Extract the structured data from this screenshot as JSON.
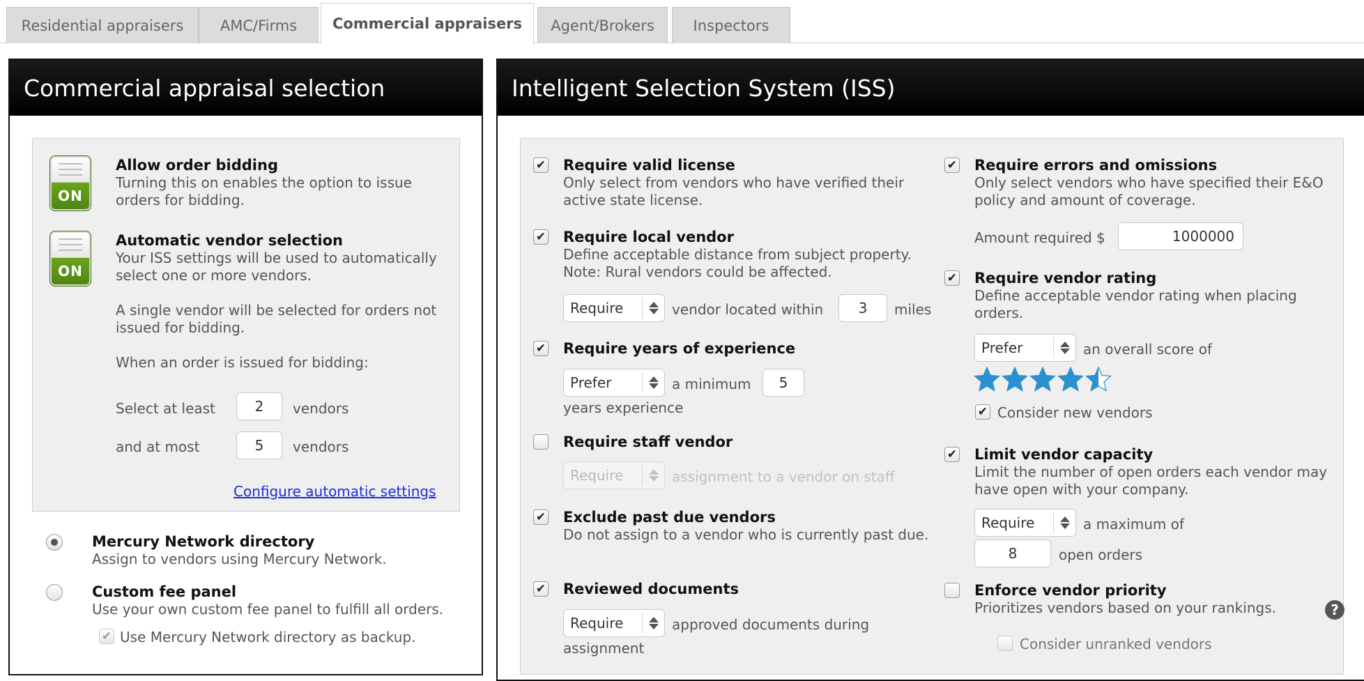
{
  "tabs": [
    {
      "label": "Residential appraisers"
    },
    {
      "label": "AMC/Firms"
    },
    {
      "label": "Commercial appraisers"
    },
    {
      "label": "Agent/Brokers"
    },
    {
      "label": "Inspectors"
    }
  ],
  "left": {
    "title": "Commercial appraisal selection",
    "bidding": {
      "toggle": "ON",
      "title": "Allow order bidding",
      "desc": "Turning this on enables the option to issue orders for bidding."
    },
    "auto": {
      "toggle": "ON",
      "title": "Automatic vendor selection",
      "desc": "Your ISS settings will be used to automatically select one or more vendors.",
      "single": "A single vendor will be selected for orders not issued for bidding.",
      "when": "When an order is issued for bidding:",
      "at_least_label": "Select at least",
      "at_least_value": "2",
      "at_most_label": "and at most",
      "at_most_value": "5",
      "vendors_word": "vendors"
    },
    "configure_link": "Configure automatic settings",
    "mercury": {
      "title": "Mercury Network directory",
      "desc": "Assign to vendors using Mercury Network."
    },
    "custom": {
      "title": "Custom fee panel",
      "desc": "Use your own custom fee panel to fulfill all orders.",
      "backup": "Use Mercury Network directory as backup."
    }
  },
  "right": {
    "title": "Intelligent Selection System (ISS)",
    "license": {
      "title": "Require valid license",
      "desc": "Only select from vendors who have verified their active state license."
    },
    "local": {
      "title": "Require local vendor",
      "desc": "Define acceptable distance from subject property. Note: Rural vendors could be affected.",
      "select": "Require",
      "mid": "vendor located within",
      "value": "3",
      "unit": "miles"
    },
    "years": {
      "title": "Require years of experience",
      "select": "Prefer",
      "mid": "a minimum",
      "value": "5",
      "unit": "years experience"
    },
    "staff": {
      "title": "Require staff vendor",
      "select": "Require",
      "rest": "assignment to a vendor on staff"
    },
    "pastdue": {
      "title": "Exclude past due vendors",
      "desc": "Do not assign to a vendor who is currently past due."
    },
    "reviewed": {
      "title": "Reviewed documents",
      "select": "Require",
      "rest1": "approved documents during",
      "rest2": "assignment"
    },
    "eo": {
      "title": "Require errors and omissions",
      "desc": "Only select vendors who have specified their E&O policy and amount of coverage.",
      "amount_label": "Amount required $",
      "amount_value": "1000000"
    },
    "rating": {
      "title": "Require vendor rating",
      "desc": "Define acceptable vendor rating when placing orders.",
      "select": "Prefer",
      "rest": "an overall score of",
      "stars": 4.5,
      "star_color": "#2b8fd0",
      "new_vendors": "Consider new vendors"
    },
    "capacity": {
      "title": "Limit vendor capacity",
      "desc": "Limit the number of open orders each vendor may have open with your company.",
      "select": "Require",
      "rest": "a maximum of",
      "value": "8",
      "unit": "open orders"
    },
    "priority": {
      "title": "Enforce vendor priority",
      "desc": "Prioritizes vendors based on your rankings.",
      "help": "?",
      "unranked": "Consider unranked vendors"
    }
  },
  "check": "✔"
}
